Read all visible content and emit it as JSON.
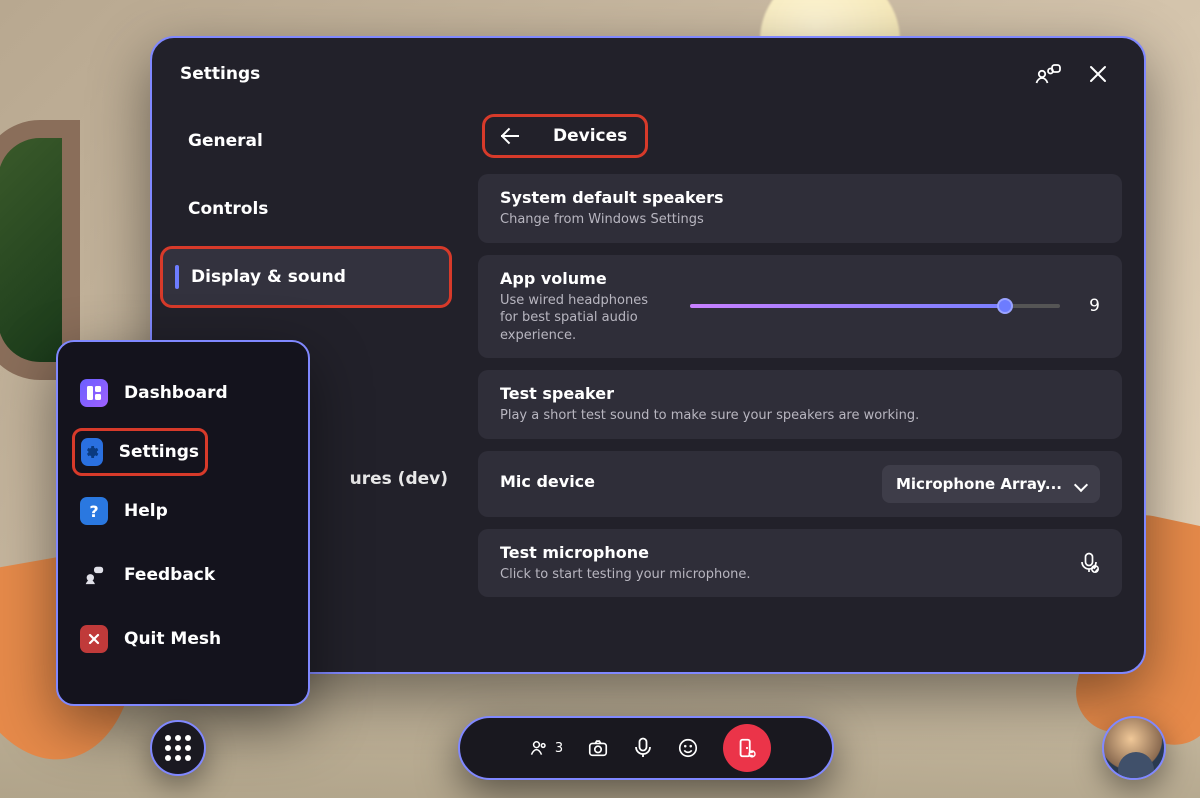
{
  "window": {
    "title": "Settings"
  },
  "sidebar": {
    "items": [
      {
        "label": "General"
      },
      {
        "label": "Controls"
      },
      {
        "label": "Display & sound"
      }
    ],
    "dev_fragment": "ures (dev)"
  },
  "content": {
    "header": {
      "back": true,
      "title": "Devices"
    },
    "speakers": {
      "title": "System default speakers",
      "subtitle": "Change from Windows Settings"
    },
    "volume": {
      "title": "App volume",
      "subtitle": "Use wired headphones for best spatial audio experience.",
      "value": "9",
      "percent": 85
    },
    "test_speaker": {
      "title": "Test speaker",
      "subtitle": "Play a short test sound to make sure your speakers are working."
    },
    "mic_device": {
      "title": "Mic device",
      "selected": "Microphone Array..."
    },
    "test_mic": {
      "title": "Test microphone",
      "subtitle": "Click to start testing your microphone."
    }
  },
  "popup": {
    "items": [
      {
        "label": "Dashboard",
        "icon": "dashboard"
      },
      {
        "label": "Settings",
        "icon": "gear"
      },
      {
        "label": "Help",
        "icon": "help"
      },
      {
        "label": "Feedback",
        "icon": "feedback"
      },
      {
        "label": "Quit Mesh",
        "icon": "quit"
      }
    ]
  },
  "bottombar": {
    "participants": "3"
  },
  "colors": {
    "panel_bg": "#22212A",
    "card_bg": "#2F2E39",
    "accent_border": "#8088ff",
    "leave_red": "#eb3449",
    "annotation_red": "#d73a2a"
  }
}
